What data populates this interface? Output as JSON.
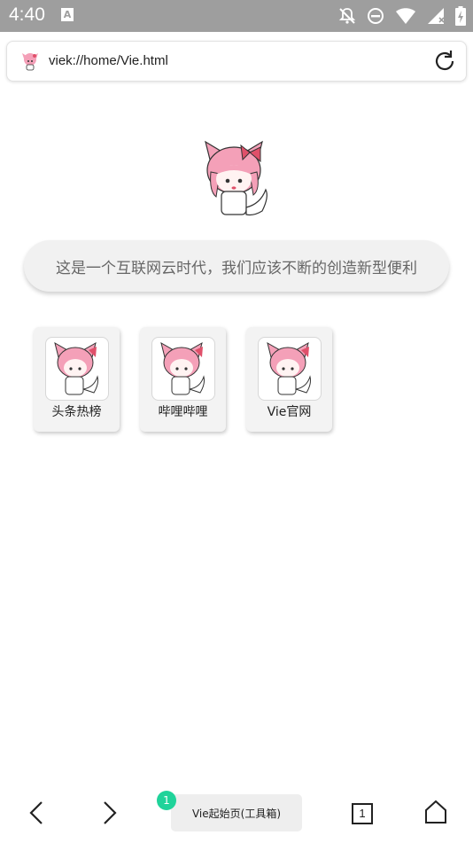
{
  "status_bar": {
    "time": "4:40",
    "keyboard_indicator": "A",
    "icons": [
      "notifications-off-icon",
      "do-not-disturb-icon",
      "wifi-icon",
      "signal-icon",
      "battery-icon"
    ]
  },
  "address_bar": {
    "url": "viek://home/Vie.html",
    "favicon": "anime-avatar-icon",
    "refresh_icon": "refresh-icon"
  },
  "main": {
    "slogan": "这是一个互联网云时代，我们应该不断的创造新型便利",
    "shortcuts": [
      {
        "label": "头条热榜"
      },
      {
        "label": "哔哩哔哩"
      },
      {
        "label": "Vie官网"
      }
    ]
  },
  "toolbar": {
    "tab_count_badge": "1",
    "page_title": "Vie起始页(工具箱)",
    "tabs_count": "1",
    "icons": [
      "back-arrow-icon",
      "forward-arrow-icon",
      "tabs-icon",
      "home-icon"
    ]
  },
  "colors": {
    "status_bar_bg": "#9e9e9e",
    "badge_green": "#1fd39a",
    "mascot_pink": "#f4a0b8",
    "bow_red": "#e0506a"
  }
}
